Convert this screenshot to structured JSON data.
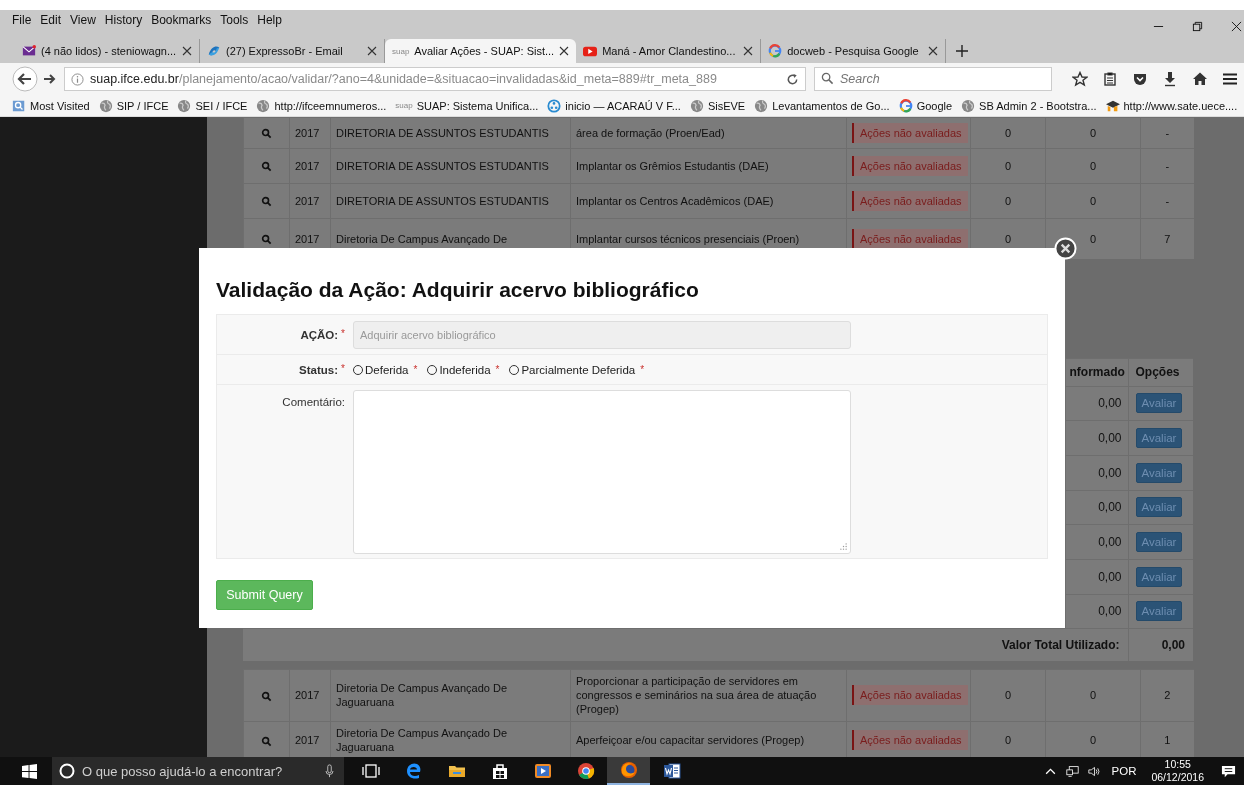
{
  "menu_bar": [
    "File",
    "Edit",
    "View",
    "History",
    "Bookmarks",
    "Tools",
    "Help"
  ],
  "tabs": [
    {
      "kind": "mail",
      "label": "(4 não lidos) - steniowagn...",
      "selected": false
    },
    {
      "kind": "expresso",
      "label": "(27) ExpressoBr - Email",
      "selected": false
    },
    {
      "kind": "suap",
      "icon_text": "suap",
      "label": "Avaliar Ações - SUAP: Sist...",
      "selected": true
    },
    {
      "kind": "video",
      "label": "Maná - Amor Clandestino...",
      "selected": false
    },
    {
      "kind": "google",
      "label": "docweb - Pesquisa Google",
      "selected": false
    }
  ],
  "address_bar": {
    "url": "**suap.ifce.edu.br**/planejamento/acao/validar/?ano=4&unidade=&situacao=invalidadas&id_meta=889#tr_meta_889",
    "search_placeholder": "Search"
  },
  "bookmarks": [
    {
      "kind": "folder",
      "label": "Most Visited"
    },
    {
      "kind": "globe",
      "label": "SIP / IFCE"
    },
    {
      "kind": "globe",
      "label": "SEI / IFCE"
    },
    {
      "kind": "globe",
      "label": "http://ifceemnumeros..."
    },
    {
      "kind": "suap",
      "icon_text": "suap",
      "label": "SUAP: Sistema Unifica..."
    },
    {
      "kind": "ring",
      "label": "inicio — ACARAÚ V F..."
    },
    {
      "kind": "globe",
      "label": "SisEVE"
    },
    {
      "kind": "globe",
      "label": "Levantamentos de Go..."
    },
    {
      "kind": "google",
      "label": "Google"
    },
    {
      "kind": "globe",
      "label": "SB Admin 2 - Bootstra..."
    },
    {
      "kind": "cap",
      "label": "http://www.sate.uece...."
    }
  ],
  "page": {
    "top_rows": [
      {
        "year": "2017",
        "unit": "DIRETORIA DE ASSUNTOS ESTUDANTIS",
        "action": "área de formação (Proen/Ead)",
        "status": "Ações não avaliadas",
        "column_6": "0",
        "column_7": "0",
        "column_8": "-"
      },
      {
        "year": "2017",
        "unit": "DIRETORIA DE ASSUNTOS ESTUDANTIS",
        "action": "Implantar os Grêmios Estudantis (DAE)",
        "status": "Ações não avaliadas",
        "column_6": "0",
        "column_7": "0",
        "column_8": "-"
      },
      {
        "year": "2017",
        "unit": "DIRETORIA DE ASSUNTOS ESTUDANTIS",
        "action": "Implantar os Centros Acadêmicos (DAE)",
        "status": "Ações não avaliadas",
        "column_6": "0",
        "column_7": "0",
        "column_8": "-"
      },
      {
        "year": "2017",
        "unit": "Diretoria De Campus Avançado De",
        "action": "Implantar cursos técnicos presenciais (Proen)",
        "status": "Ações não avaliadas",
        "column_6": "0",
        "column_7": "0",
        "column_8": "7"
      }
    ],
    "meta_table": {
      "columns": [
        "nformado",
        "Opções"
      ],
      "rows": [
        {
          "value": "0,00",
          "button": "Avaliar"
        },
        {
          "value": "0,00",
          "button": "Avaliar"
        },
        {
          "value": "0,00",
          "button": "Avaliar"
        },
        {
          "value": "0,00",
          "button": "Avaliar"
        },
        {
          "value": "0,00",
          "button": "Avaliar"
        },
        {
          "value": "0,00",
          "button": "Avaliar"
        },
        {
          "value": "0,00",
          "button": "Avaliar"
        }
      ],
      "total_label": "Valor Total Utilizado:",
      "total_value": "0,00"
    },
    "bottom_rows": [
      {
        "year": "2017",
        "unit": "Diretoria De Campus Avançado De Jaguaruana",
        "action": "Proporcionar a participação de servidores em congressos e seminários na sua área de atuação (Progep)",
        "status": "Ações não avaliadas",
        "column_6": "0",
        "column_7": "0",
        "column_8": "2"
      },
      {
        "year": "2017",
        "unit": "Diretoria De Campus Avançado De Jaguaruana",
        "action": "Aperfeiçoar e/ou capacitar servidores (Progep)",
        "status": "Ações não avaliadas",
        "column_6": "0",
        "column_7": "0",
        "column_8": "1"
      }
    ]
  },
  "modal": {
    "title": "Validação da Ação: Adquirir acervo bibliográfico",
    "action_field": {
      "label": "AÇÃO:",
      "required_mark": "*",
      "value": "Adquirir acervo bibliográfico",
      "disabled": true
    },
    "status_field": {
      "label": "Status:",
      "required_mark": "*",
      "options": [
        {
          "label": "Deferida",
          "required_mark": "*",
          "selected": false
        },
        {
          "label": "Indeferida",
          "required_mark": "*",
          "selected": false
        },
        {
          "label": "Parcialmente Deferida",
          "required_mark": "*",
          "selected": false
        }
      ]
    },
    "comment_field": {
      "label": "Comentário:"
    },
    "submit": "Submit Query"
  },
  "taskbar": {
    "search_placeholder": "O que posso ajudá-lo a encontrar?",
    "apps": [
      {
        "kind": "task-view",
        "selected": false
      },
      {
        "kind": "edge",
        "selected": false
      },
      {
        "kind": "explorer",
        "selected": false
      },
      {
        "kind": "store",
        "selected": false
      },
      {
        "kind": "media",
        "selected": false
      },
      {
        "kind": "chrome",
        "selected": false
      },
      {
        "kind": "firefox",
        "selected": true
      },
      {
        "kind": "word",
        "selected": false
      }
    ],
    "language": "POR",
    "time": "10:55",
    "date": "06/12/2016"
  }
}
